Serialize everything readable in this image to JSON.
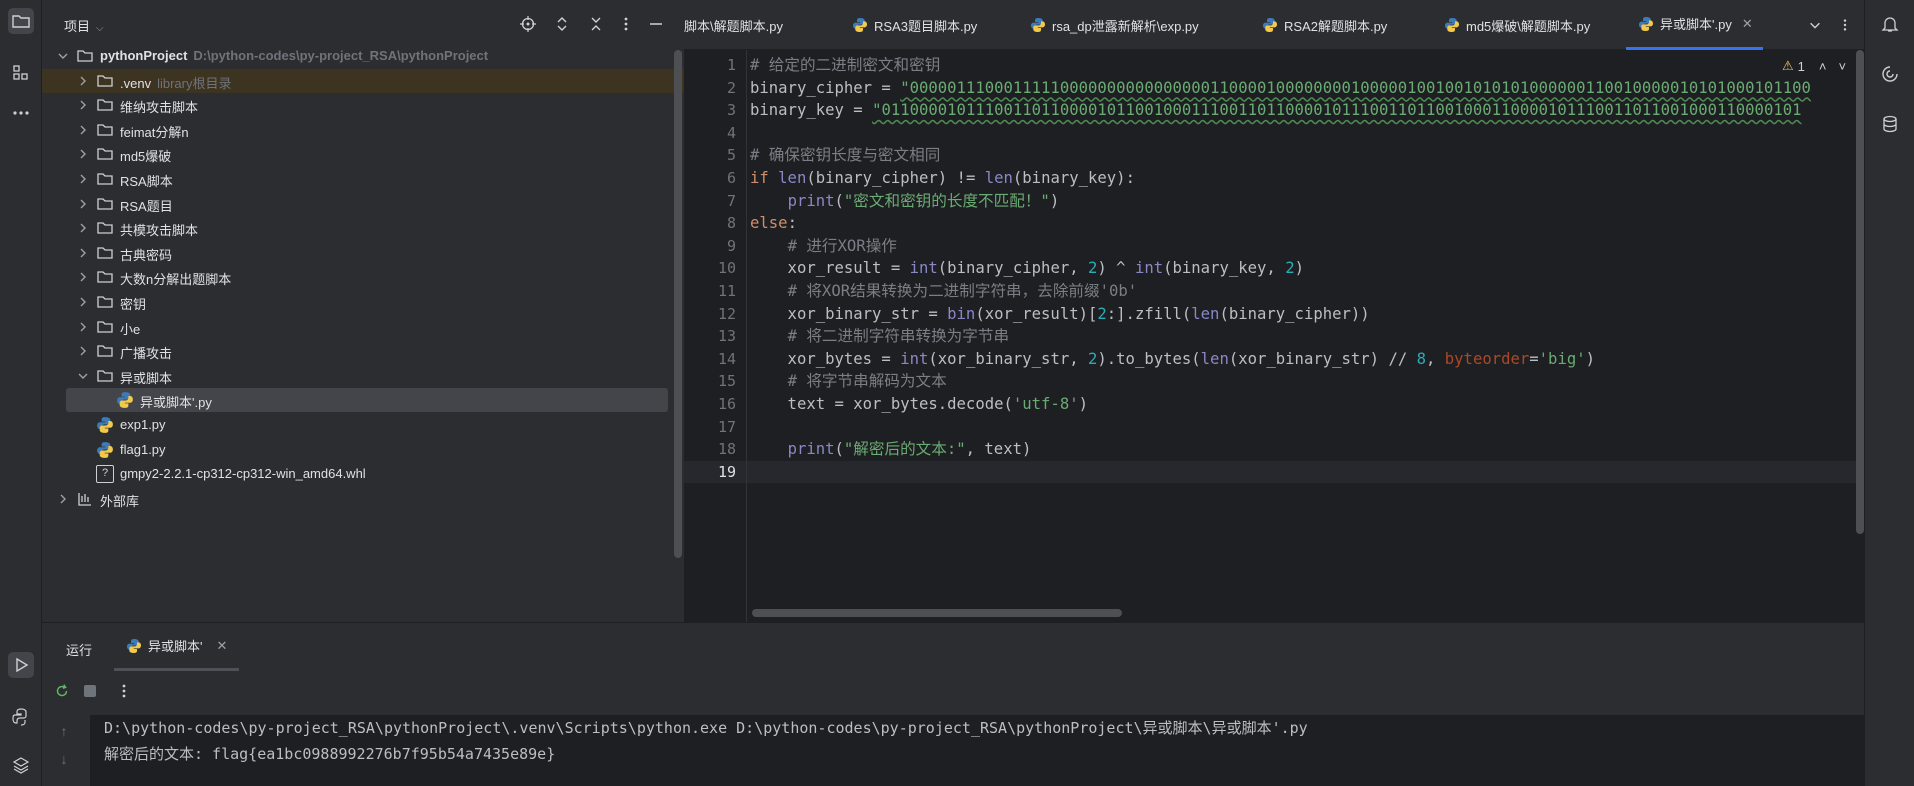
{
  "project_panel": {
    "title": "项目",
    "tree": [
      {
        "label": "pythonProject",
        "hint": "D:\\python-codes\\py-project_RSA\\pythonProject",
        "type": "folder",
        "expanded": true
      },
      {
        "label": ".venv",
        "hint": "library根目录",
        "type": "folder",
        "expanded": false
      },
      {
        "label": "维纳攻击脚本",
        "hint": "",
        "type": "folder",
        "expanded": false
      },
      {
        "label": "feimat分解n",
        "hint": "",
        "type": "folder",
        "expanded": false
      },
      {
        "label": "md5爆破",
        "hint": "",
        "type": "folder",
        "expanded": false
      },
      {
        "label": "RSA脚本",
        "hint": "",
        "type": "folder",
        "expanded": false
      },
      {
        "label": "RSA题目",
        "hint": "",
        "type": "folder",
        "expanded": false
      },
      {
        "label": "共模攻击脚本",
        "hint": "",
        "type": "folder",
        "expanded": false
      },
      {
        "label": "古典密码",
        "hint": "",
        "type": "folder",
        "expanded": false
      },
      {
        "label": "大数n分解出题脚本",
        "hint": "",
        "type": "folder",
        "expanded": false
      },
      {
        "label": "密钥",
        "hint": "",
        "type": "folder",
        "expanded": false
      },
      {
        "label": "小e",
        "hint": "",
        "type": "folder",
        "expanded": false
      },
      {
        "label": "广播攻击",
        "hint": "",
        "type": "folder",
        "expanded": false
      },
      {
        "label": "异或脚本",
        "hint": "",
        "type": "folder",
        "expanded": true
      },
      {
        "label": "异或脚本'.py",
        "hint": "",
        "type": "python"
      },
      {
        "label": "exp1.py",
        "hint": "",
        "type": "python"
      },
      {
        "label": "flag1.py",
        "hint": "",
        "type": "python"
      },
      {
        "label": "gmpy2-2.2.1-cp312-cp312-win_amd64.whl",
        "hint": "",
        "type": "unknown"
      },
      {
        "label": "外部库",
        "hint": "",
        "type": "library",
        "expanded": false
      }
    ]
  },
  "editor_tabs": [
    {
      "label": "脚本\\解题脚本.py",
      "active": false
    },
    {
      "label": "RSA3题目脚本.py",
      "active": false
    },
    {
      "label": "rsa_dp泄露新解析\\exp.py",
      "active": false
    },
    {
      "label": "RSA2解题脚本.py",
      "active": false
    },
    {
      "label": "md5爆破\\解题脚本.py",
      "active": false
    },
    {
      "label": "异或脚本'.py",
      "active": true
    }
  ],
  "inspection": {
    "warning_count": "1"
  },
  "editor": {
    "current_line": 19,
    "lines": [
      [
        [
          "cm",
          "# 给定的二进制密文和密钥"
        ]
      ],
      [
        [
          "tx",
          "binary_cipher = "
        ],
        [
          "stw",
          "\"000001110001111100000000000000001100001000000001000001001001010101000000110010000010101000101100"
        ]
      ],
      [
        [
          "tx",
          "binary_key = "
        ],
        [
          "stw",
          "\"01100001011100110110000101100100011100110110000101110011011001000110000101110011011001000110000101"
        ]
      ],
      [],
      [
        [
          "cm",
          "# 确保密钥长度与密文相同"
        ]
      ],
      [
        [
          "kw",
          "if "
        ],
        [
          "bi",
          "len"
        ],
        [
          "tx",
          "(binary_cipher) != "
        ],
        [
          "bi",
          "len"
        ],
        [
          "tx",
          "(binary_key):"
        ]
      ],
      [
        [
          "tx",
          "    "
        ],
        [
          "bi",
          "print"
        ],
        [
          "tx",
          "("
        ],
        [
          "st",
          "\"密文和密钥的长度不匹配！\""
        ],
        [
          "tx",
          ")"
        ]
      ],
      [
        [
          "kw",
          "else"
        ],
        [
          "tx",
          ":"
        ]
      ],
      [
        [
          "tx",
          "    "
        ],
        [
          "cm",
          "# 进行XOR操作"
        ]
      ],
      [
        [
          "tx",
          "    xor_result = "
        ],
        [
          "bi",
          "int"
        ],
        [
          "tx",
          "(binary_cipher, "
        ],
        [
          "nu",
          "2"
        ],
        [
          "tx",
          ") ^ "
        ],
        [
          "bi",
          "int"
        ],
        [
          "tx",
          "(binary_key, "
        ],
        [
          "nu",
          "2"
        ],
        [
          "tx",
          ")"
        ]
      ],
      [
        [
          "tx",
          "    "
        ],
        [
          "cm",
          "# 将XOR结果转换为二进制字符串，去除前缀'0b'"
        ]
      ],
      [
        [
          "tx",
          "    xor_binary_str = "
        ],
        [
          "bi",
          "bin"
        ],
        [
          "tx",
          "(xor_result)["
        ],
        [
          "nu",
          "2"
        ],
        [
          "tx",
          ":].zfill("
        ],
        [
          "bi",
          "len"
        ],
        [
          "tx",
          "(binary_cipher))"
        ]
      ],
      [
        [
          "tx",
          "    "
        ],
        [
          "cm",
          "# 将二进制字符串转换为字节串"
        ]
      ],
      [
        [
          "tx",
          "    xor_bytes = "
        ],
        [
          "bi",
          "int"
        ],
        [
          "tx",
          "(xor_binary_str, "
        ],
        [
          "nu",
          "2"
        ],
        [
          "tx",
          ").to_bytes("
        ],
        [
          "bi",
          "len"
        ],
        [
          "tx",
          "(xor_binary_str) // "
        ],
        [
          "nu",
          "8"
        ],
        [
          "tx",
          ", "
        ],
        [
          "pm",
          "byteorder"
        ],
        [
          "tx",
          "="
        ],
        [
          "st",
          "'big'"
        ],
        [
          "tx",
          ")"
        ]
      ],
      [
        [
          "tx",
          "    "
        ],
        [
          "cm",
          "# 将字节串解码为文本"
        ]
      ],
      [
        [
          "tx",
          "    text = xor_bytes.decode("
        ],
        [
          "st",
          "'utf-8'"
        ],
        [
          "tx",
          ")"
        ]
      ],
      [],
      [
        [
          "tx",
          "    "
        ],
        [
          "bi",
          "print"
        ],
        [
          "tx",
          "("
        ],
        [
          "st",
          "\"解密后的文本:\""
        ],
        [
          "tx",
          ", text)"
        ]
      ],
      []
    ]
  },
  "run_panel": {
    "label": "运行",
    "tab_label": "异或脚本'",
    "console": [
      "D:\\python-codes\\py-project_RSA\\pythonProject\\.venv\\Scripts\\python.exe D:\\python-codes\\py-project_RSA\\pythonProject\\异或脚本\\异或脚本'.py",
      "解密后的文本: flag{ea1bc0988992276b7f95b54a7435e89e}"
    ]
  },
  "colors": {
    "accent": "#3574f0",
    "background": "#1e1f22",
    "panel": "#2b2d30"
  }
}
